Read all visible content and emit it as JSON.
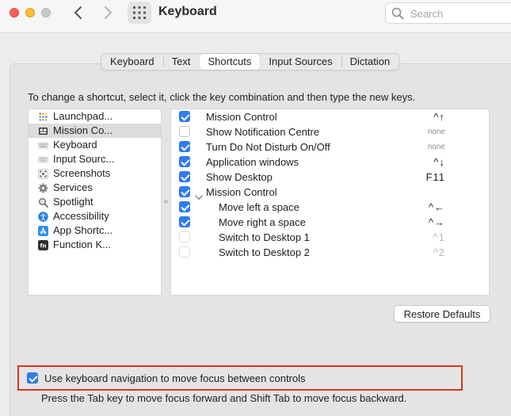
{
  "window": {
    "title": "Keyboard",
    "search_placeholder": "Search"
  },
  "tabs": [
    {
      "label": "Keyboard",
      "active": false
    },
    {
      "label": "Text",
      "active": false
    },
    {
      "label": "Shortcuts",
      "active": true
    },
    {
      "label": "Input Sources",
      "active": false
    },
    {
      "label": "Dictation",
      "active": false
    }
  ],
  "instructions": "To change a shortcut, select it, click the key combination and then type the new keys.",
  "categories": [
    {
      "label": "Launchpad...",
      "icon": "launchpad-icon",
      "selected": false
    },
    {
      "label": "Mission Co...",
      "icon": "mission-control-icon",
      "selected": true
    },
    {
      "label": "Keyboard",
      "icon": "keyboard-icon",
      "selected": false
    },
    {
      "label": "Input Sourc...",
      "icon": "input-sources-icon",
      "selected": false
    },
    {
      "label": "Screenshots",
      "icon": "screenshot-icon",
      "selected": false
    },
    {
      "label": "Services",
      "icon": "gear-icon",
      "selected": false
    },
    {
      "label": "Spotlight",
      "icon": "magnifier-icon",
      "selected": false
    },
    {
      "label": "Accessibility",
      "icon": "accessibility-icon",
      "selected": false
    },
    {
      "label": "App Shortc...",
      "icon": "app-store-icon",
      "selected": false
    },
    {
      "label": "Function K...",
      "icon": "fn-key-icon",
      "selected": false
    }
  ],
  "shortcuts": [
    {
      "label": "Mission Control",
      "key": "^↑",
      "checked": true,
      "indent": false,
      "disclosure": false,
      "key_style": "normal"
    },
    {
      "label": "Show Notification Centre",
      "key": "none",
      "checked": false,
      "indent": false,
      "disclosure": false,
      "key_style": "none"
    },
    {
      "label": "Turn Do Not Disturb On/Off",
      "key": "none",
      "checked": true,
      "indent": false,
      "disclosure": false,
      "key_style": "none"
    },
    {
      "label": "Application windows",
      "key": "^↓",
      "checked": true,
      "indent": false,
      "disclosure": false,
      "key_style": "normal"
    },
    {
      "label": "Show Desktop",
      "key": "F11",
      "checked": true,
      "indent": false,
      "disclosure": false,
      "key_style": "normal"
    },
    {
      "label": "Mission Control",
      "key": "",
      "checked": true,
      "indent": false,
      "disclosure": true,
      "key_style": "normal"
    },
    {
      "label": "Move left a space",
      "key": "^←",
      "checked": true,
      "indent": true,
      "disclosure": false,
      "key_style": "normal"
    },
    {
      "label": "Move right a space",
      "key": "^→",
      "checked": true,
      "indent": true,
      "disclosure": false,
      "key_style": "normal"
    },
    {
      "label": "Switch to Desktop 1",
      "key": "^1",
      "checked": false,
      "indent": true,
      "disclosure": false,
      "key_style": "dim"
    },
    {
      "label": "Switch to Desktop 2",
      "key": "^2",
      "checked": false,
      "indent": true,
      "disclosure": false,
      "key_style": "dim"
    }
  ],
  "restore_button": "Restore Defaults",
  "keyboard_navigation": {
    "label": "Use keyboard navigation to move focus between controls",
    "checked": true,
    "hint": "Press the Tab key to move focus forward and Shift Tab to move focus backward."
  },
  "colors": {
    "accent": "#2f7cf6",
    "highlight_border": "#e0301e"
  }
}
